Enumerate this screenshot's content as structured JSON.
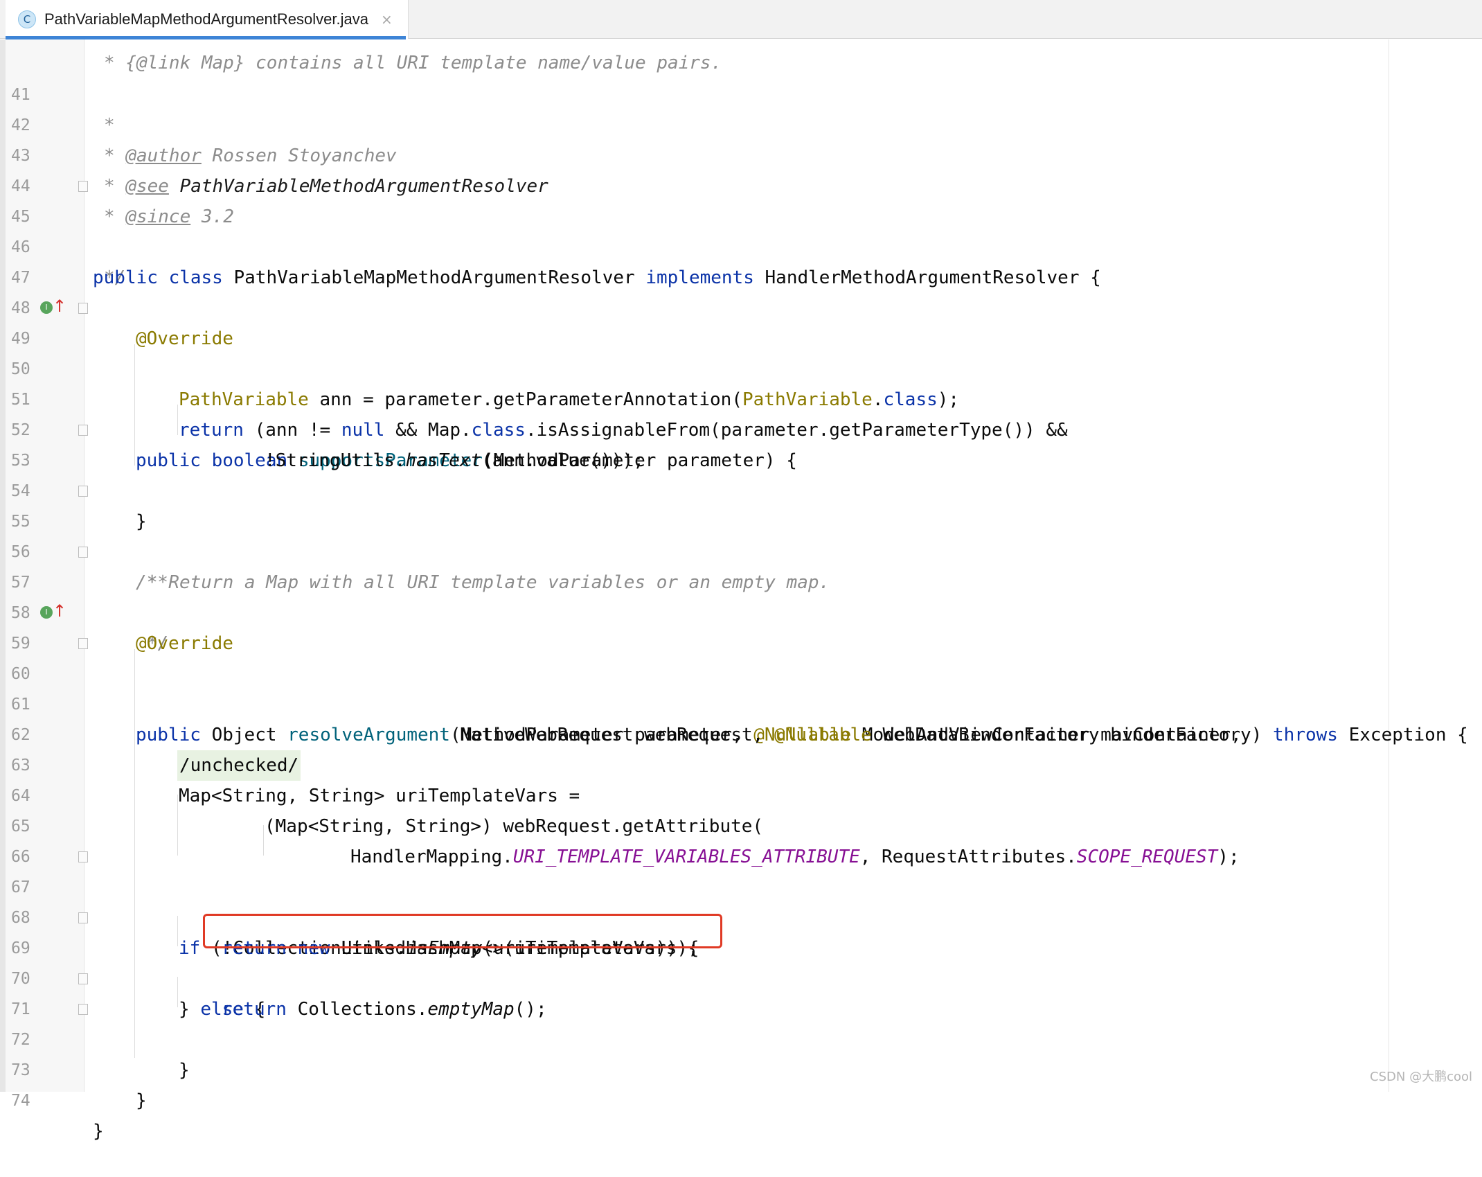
{
  "tab": {
    "icon": "C",
    "title": "PathVariableMapMethodArgumentResolver.java",
    "close": "×"
  },
  "partial_top_line": "* {@link Map} contains all URI template name/value pairs.",
  "lines": [
    {
      "n": "41",
      "t": "*"
    },
    {
      "n": "42",
      "t": "* @author Rossen Stoyanchev"
    },
    {
      "n": "43",
      "t": "* @see PathVariableMethodArgumentResolver"
    },
    {
      "n": "44",
      "t": "* @since 3.2"
    },
    {
      "n": "45",
      "t": "*/"
    },
    {
      "n": "46",
      "t": "public class PathVariableMapMethodArgumentResolver implements HandlerMethodArgumentResolver {"
    },
    {
      "n": "47",
      "t": ""
    },
    {
      "n": "48",
      "t": "@Override"
    },
    {
      "n": "49",
      "t": "public boolean supportsParameter(MethodParameter parameter) {"
    },
    {
      "n": "50",
      "t": "PathVariable ann = parameter.getParameterAnnotation(PathVariable.class);"
    },
    {
      "n": "51",
      "t": "return (ann != null && Map.class.isAssignableFrom(parameter.getParameterType()) &&"
    },
    {
      "n": "52",
      "t": "!StringUtils.hasText(ann.value()));"
    },
    {
      "n": "53",
      "t": "}"
    },
    {
      "n": "54",
      "t": ""
    },
    {
      "n": "55",
      "t": "/**"
    },
    {
      "n": "56",
      "t": "* Return a Map with all URI template variables or an empty map."
    },
    {
      "n": "57",
      "t": "*/"
    },
    {
      "n": "58",
      "t": "@Override"
    },
    {
      "n": "59",
      "t": "public Object resolveArgument(MethodParameter parameter, @Nullable ModelAndViewContainer mavContainer,"
    },
    {
      "n": "60",
      "t": "NativeWebRequest webRequest, @Nullable WebDataBinderFactory binderFactory) throws Exception {"
    },
    {
      "n": "61",
      "t": ""
    },
    {
      "n": "62",
      "t": "/unchecked/"
    },
    {
      "n": "63",
      "t": "Map<String, String> uriTemplateVars ="
    },
    {
      "n": "64",
      "t": "(Map<String, String>) webRequest.getAttribute("
    },
    {
      "n": "65",
      "t": "HandlerMapping.URI_TEMPLATE_VARIABLES_ATTRIBUTE, RequestAttributes.SCOPE_REQUEST);"
    },
    {
      "n": "66",
      "t": ""
    },
    {
      "n": "67",
      "t": "if (!CollectionUtils.isEmpty(uriTemplateVars)) {"
    },
    {
      "n": "68",
      "t": "return new LinkedHashMap<>(uriTemplateVars);"
    },
    {
      "n": "69",
      "t": "} else {"
    },
    {
      "n": "70",
      "t": "return Collections.emptyMap();"
    },
    {
      "n": "71",
      "t": "}"
    },
    {
      "n": "72",
      "t": "}"
    },
    {
      "n": "73",
      "t": ""
    },
    {
      "n": "74",
      "t": "}"
    }
  ],
  "gutter_marks": {
    "implements_icon": "I",
    "arrow": "↑"
  },
  "watermark": "CSDN @大鹏cool",
  "colors": {
    "keyword": "#0b33a8",
    "annotation": "#8a7a00",
    "comment": "#8c8c8c",
    "method": "#00627a",
    "constant": "#871094",
    "highlight_box": "#e03a25"
  }
}
